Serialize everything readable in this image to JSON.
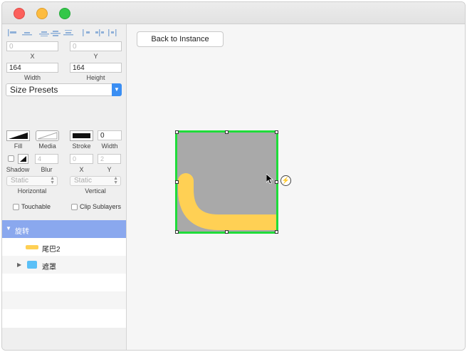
{
  "window": {
    "traffic_lights": {
      "close": "#fc605c",
      "minimize": "#fdbc40",
      "zoom": "#34c749"
    }
  },
  "inspector": {
    "position": {
      "x_value": "0",
      "y_value": "0",
      "x_label": "X",
      "y_label": "Y"
    },
    "size": {
      "width_value": "164",
      "height_value": "164",
      "width_label": "Width",
      "height_label": "Height"
    },
    "size_presets": "Size Presets",
    "appearance": {
      "fill_label": "Fill",
      "media_label": "Media",
      "stroke_label": "Stroke",
      "width_label": "Width",
      "stroke_width_value": "0"
    },
    "shadow": {
      "shadow_label": "Shadow",
      "blur_label": "Blur",
      "x_label": "X",
      "y_label": "Y",
      "blur_value": "4",
      "x_value": "0",
      "y_value": "2"
    },
    "constraints": {
      "horizontal_value": "Static",
      "vertical_value": "Static",
      "horizontal_label": "Horizontal",
      "vertical_label": "Vertical"
    },
    "options": {
      "touchable_label": "Touchable",
      "clip_sublayers_label": "Clip Sublayers"
    }
  },
  "layers": [
    {
      "name": "旋转",
      "selected": true
    },
    {
      "name": "尾巴2",
      "color": "#ffd054"
    },
    {
      "name": "遮罩",
      "color": "#5bc0f7"
    }
  ],
  "canvas": {
    "back_button_label": "Back to Instance",
    "selection_color": "#1fdc3a",
    "artboard_fill": "#a9a9a9",
    "shape_color": "#ffd054",
    "bolt_icon": "⚡"
  }
}
